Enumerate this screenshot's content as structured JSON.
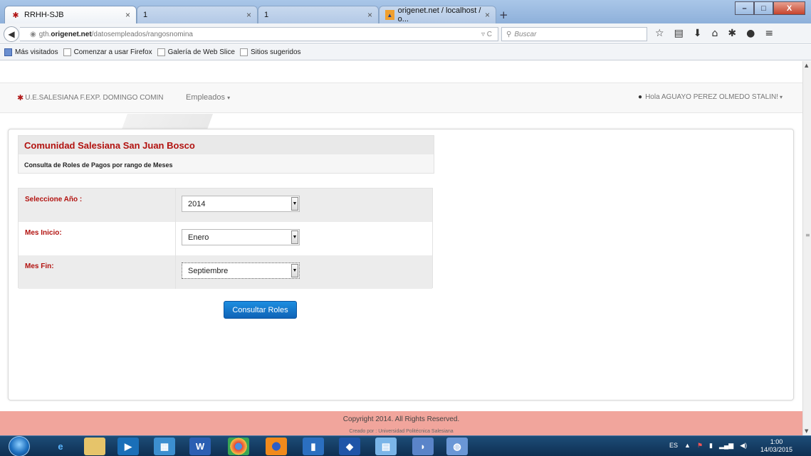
{
  "browser": {
    "tabs": [
      {
        "title": "RRHH-SJB"
      },
      {
        "title": "1"
      },
      {
        "title": "1"
      },
      {
        "title": "origenet.net / localhost / o..."
      }
    ],
    "url_prefix": "gth.",
    "url_domain": "origenet.net",
    "url_path": "/datosempleados/rangosnomina",
    "search_placeholder": "Buscar",
    "bookmarks": [
      "Más visitados",
      "Comenzar a usar Firefox",
      "Galería de Web Slice",
      "Sitios sugeridos"
    ]
  },
  "app": {
    "brand": "U.E.SALESIANA F.EXP. DOMINGO COMIN",
    "menu_employees": "Empleados",
    "user_greeting": "Hola AGUAYO PEREZ OLMEDO STALIN!"
  },
  "header": {
    "title": "Comunidad Salesiana San Juan Bosco",
    "subtitle": "Consulta de Roles de Pagos por rango de Meses"
  },
  "form": {
    "year_label": "Seleccione Año :",
    "year_value": "2014",
    "start_label": "Mes Inicio:",
    "start_value": "Enero",
    "end_label": "Mes Fin:",
    "end_value": "Septiembre",
    "submit_label": "Consultar Roles"
  },
  "footer": {
    "copyright": "Copyright 2014. All Rights Reserved.",
    "credit": "Creado por : Universidad Politécnica Salesiana"
  },
  "taskbar": {
    "lang": "ES",
    "time": "1:00",
    "date": "14/03/2015"
  }
}
